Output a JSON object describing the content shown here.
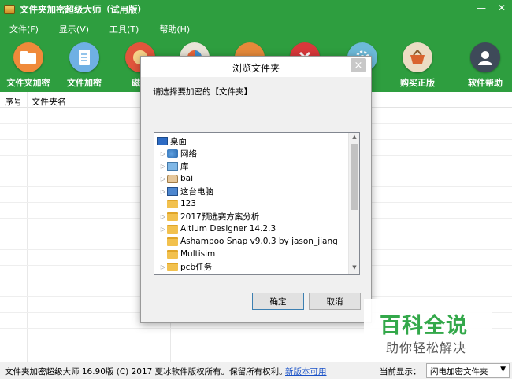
{
  "window": {
    "title": "文件夹加密超级大师（试用版）",
    "controls": [
      "—",
      "✕"
    ]
  },
  "menu": [
    "文件(F)",
    "显示(V)",
    "工具(T)",
    "帮助(H)"
  ],
  "toolbar": {
    "items": [
      {
        "label": "文件夹加密",
        "icon": "folder-lock-icon",
        "color": "#f08a3a"
      },
      {
        "label": "文件加密",
        "icon": "document-icon",
        "color": "#6fb0e4"
      },
      {
        "label": "磁盘",
        "icon": "disk-icon",
        "color": "#e2553c"
      },
      {
        "label": "",
        "icon": "chart-icon",
        "color": "#e9e4d8"
      },
      {
        "label": "",
        "icon": "lock-icon",
        "color": "#e5893a"
      },
      {
        "label": "",
        "icon": "delete-icon",
        "color": "#d8393b"
      },
      {
        "label": "",
        "icon": "gear-icon",
        "color": "#6dbad9"
      },
      {
        "label": "购买正版",
        "icon": "basket-icon",
        "color": "#ecdcc4"
      },
      {
        "label": "软件帮助",
        "icon": "user-help-icon",
        "color": "#3e4a59"
      }
    ]
  },
  "table": {
    "columns": [
      "序号",
      "文件夹名"
    ]
  },
  "dialog": {
    "title": "浏览文件夹",
    "close_label": "×",
    "prompt": "请选择要加密的【文件夹】",
    "tree": [
      {
        "label": "桌面",
        "icon": "desktop-icon",
        "level": 0,
        "expandable": false
      },
      {
        "label": "网络",
        "icon": "network-icon",
        "level": 1,
        "expandable": true
      },
      {
        "label": "库",
        "icon": "library-icon",
        "level": 1,
        "expandable": true
      },
      {
        "label": "bai",
        "icon": "user-folder-icon",
        "level": 1,
        "expandable": true
      },
      {
        "label": "这台电脑",
        "icon": "computer-icon",
        "level": 1,
        "expandable": true
      },
      {
        "label": "123",
        "icon": "folder-icon",
        "level": 1,
        "expandable": false
      },
      {
        "label": "2017预选赛方案分析",
        "icon": "folder-icon",
        "level": 1,
        "expandable": true
      },
      {
        "label": "Altium Designer 14.2.3",
        "icon": "folder-icon",
        "level": 1,
        "expandable": true
      },
      {
        "label": "Ashampoo Snap v9.0.3 by jason_jiang",
        "icon": "folder-icon",
        "level": 1,
        "expandable": false
      },
      {
        "label": "Multisim",
        "icon": "folder-icon",
        "level": 1,
        "expandable": false
      },
      {
        "label": "pcb任务",
        "icon": "folder-icon",
        "level": 1,
        "expandable": true
      }
    ],
    "ok_label": "确定",
    "cancel_label": "取消"
  },
  "statusbar": {
    "copyright": "文件夹加密超级大师 16.90版 (C) 2017  夏冰软件版权所有。保留所有权利。",
    "update_link": "新版本可用",
    "current_label": "当前显示：",
    "current_value": "闪电加密文件夹"
  },
  "watermark": {
    "title": "百科全说",
    "subtitle": "助你轻松解决"
  }
}
